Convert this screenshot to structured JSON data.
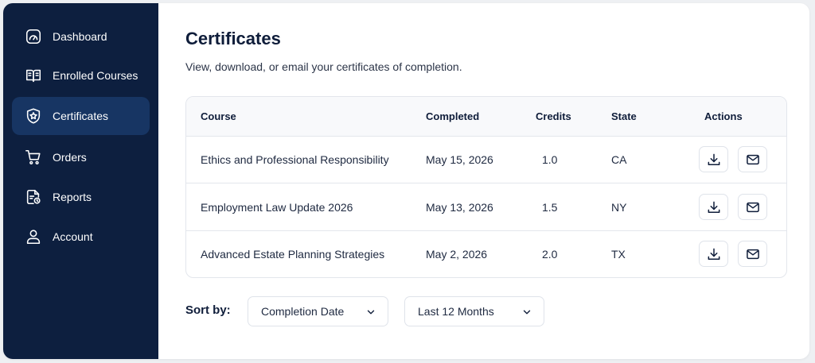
{
  "sidebar": {
    "items": [
      {
        "label": "Dashboard",
        "icon": "gauge-icon"
      },
      {
        "label": "Enrolled Courses",
        "icon": "book-icon"
      },
      {
        "label": "Certificates",
        "icon": "badge-icon",
        "active": true
      },
      {
        "label": "Orders",
        "icon": "cart-icon"
      },
      {
        "label": "Reports",
        "icon": "report-icon"
      },
      {
        "label": "Account",
        "icon": "user-icon"
      }
    ]
  },
  "page": {
    "title": "Certificates",
    "subtitle": "View, download, or email your certificates of completion."
  },
  "table": {
    "headers": {
      "course": "Course",
      "completed": "Completed",
      "credits": "Credits",
      "state": "State",
      "actions": "Actions"
    },
    "rows": [
      {
        "course": "Ethics and Professional Responsibility",
        "completed": "May 15, 2026",
        "credits": "1.0",
        "state": "CA"
      },
      {
        "course": "Employment Law Update 2026",
        "completed": "May 13, 2026",
        "credits": "1.5",
        "state": "NY"
      },
      {
        "course": "Advanced Estate Planning Strategies",
        "completed": "May 2, 2026",
        "credits": "2.0",
        "state": "TX"
      }
    ],
    "actions": [
      "download-icon",
      "mail-icon"
    ]
  },
  "sort": {
    "label": "Sort by:",
    "order_value": "Completion Date",
    "range_value": "Last 12 Months"
  },
  "colors": {
    "sidebar_bg": "#0d1f3f",
    "sidebar_active": "#173563",
    "accent": "#0f1d3a"
  }
}
